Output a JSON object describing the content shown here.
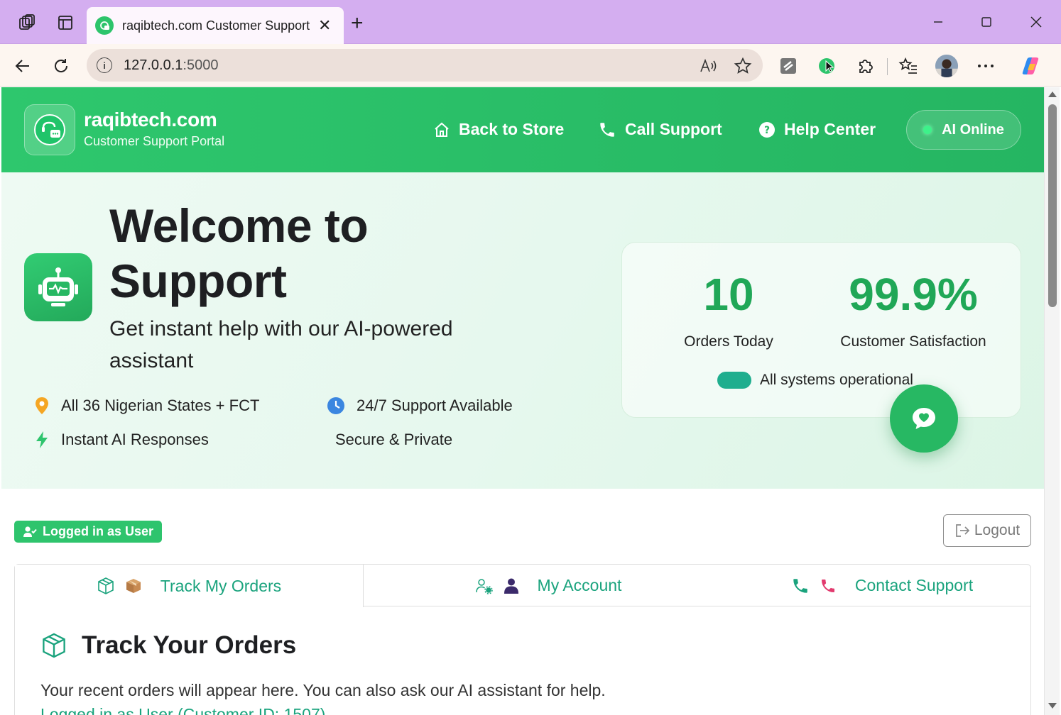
{
  "browser": {
    "tab_title": "raqibtech.com Customer Support",
    "url_host": "127.0.0.1",
    "url_port": ":5000"
  },
  "header": {
    "brand": "raqibtech.com",
    "subtitle": "Customer Support Portal",
    "nav": {
      "back_to_store": "Back to Store",
      "call_support": "Call Support",
      "help_center": "Help Center"
    },
    "ai_status": "AI Online"
  },
  "hero": {
    "title": "Welcome to Support",
    "subtitle": "Get instant help with our AI-powered assistant",
    "features": {
      "states": "All 36 Nigerian States + FCT",
      "support": "24/7 Support Available",
      "instant": "Instant AI Responses",
      "secure": "Secure & Private"
    }
  },
  "stats": {
    "orders_value": "10",
    "orders_label": "Orders Today",
    "satisfaction_value": "99.9%",
    "satisfaction_label": "Customer Satisfaction",
    "system_status": "All systems operational"
  },
  "session": {
    "badge": "Logged in as User",
    "logout": "Logout"
  },
  "tabs": {
    "track": "Track My Orders",
    "account": "My Account",
    "contact": "Contact Support"
  },
  "orders_section": {
    "title": "Track Your Orders",
    "description": "Your recent orders will appear here. You can also ask our AI assistant for help.",
    "user_line": "Logged in as User (Customer ID: 1507)"
  },
  "colors": {
    "brand_green": "#2ec76d",
    "accent_teal": "#1aa37d",
    "browser_tab_bar": "#d4aef0"
  }
}
